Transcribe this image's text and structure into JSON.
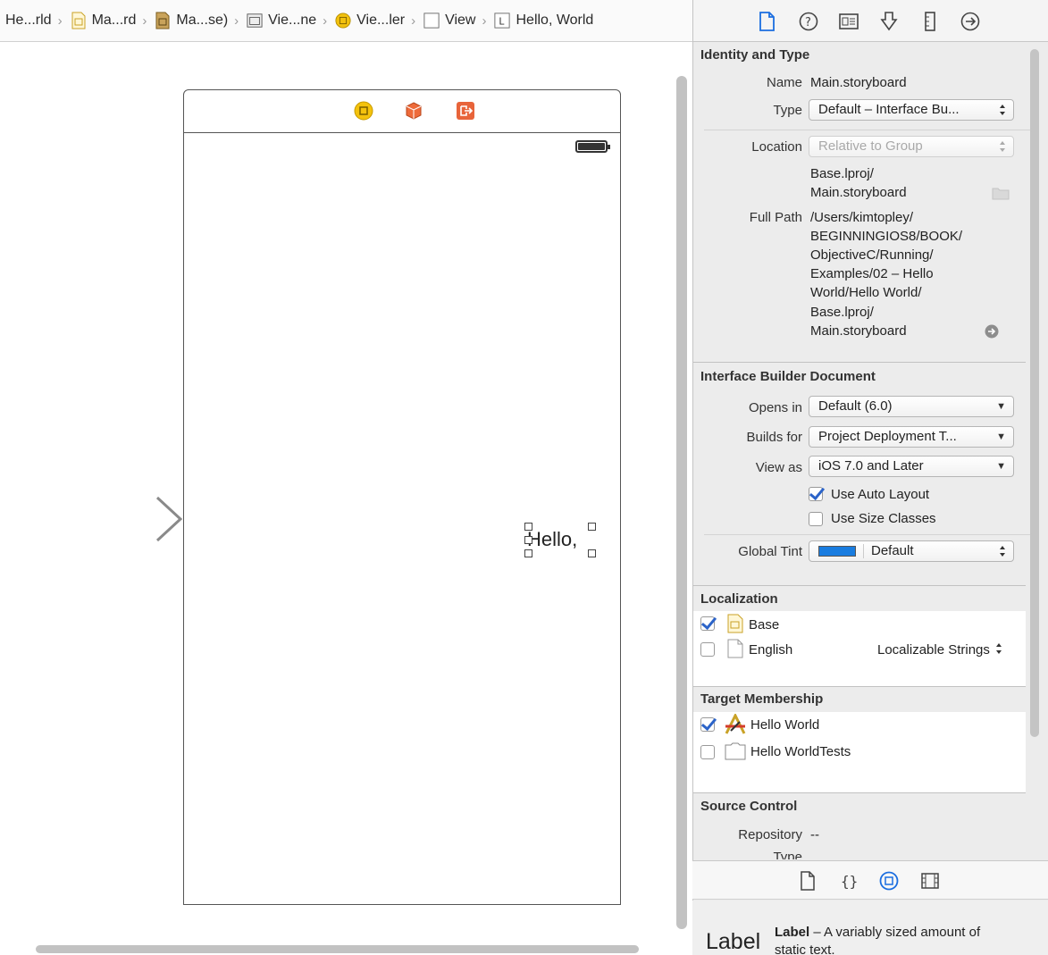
{
  "jumpbar": {
    "items": [
      {
        "label": "He...rld",
        "icon": "project-icon"
      },
      {
        "label": "Ma...rd",
        "icon": "storyboard-icon"
      },
      {
        "label": "Ma...se)",
        "icon": "storyboard-base-icon"
      },
      {
        "label": "Vie...ne",
        "icon": "scene-icon"
      },
      {
        "label": "Vie...ler",
        "icon": "view-controller-icon"
      },
      {
        "label": "View",
        "icon": "view-icon"
      },
      {
        "label": "Hello, World",
        "icon": "label-icon"
      }
    ],
    "separator": "›"
  },
  "canvas": {
    "label_text": "Hello, World"
  },
  "inspector": {
    "identity": {
      "heading": "Identity and Type",
      "name_label": "Name",
      "name_value": "Main.storyboard",
      "type_label": "Type",
      "type_value": "Default – Interface Bu...",
      "location_label": "Location",
      "location_value": "Relative to Group",
      "location_path_1": "Base.lproj/",
      "location_path_2": "Main.storyboard",
      "fullpath_label": "Full Path",
      "fullpath_lines": [
        "/Users/kimtopley/",
        "BEGINNINGIOS8/BOOK/",
        "ObjectiveC/Running/",
        "Examples/02 – Hello",
        "World/Hello World/",
        "Base.lproj/",
        "Main.storyboard"
      ]
    },
    "ibdoc": {
      "heading": "Interface Builder Document",
      "opens_in_label": "Opens in",
      "opens_in_value": "Default (6.0)",
      "builds_for_label": "Builds for",
      "builds_for_value": "Project Deployment T...",
      "view_as_label": "View as",
      "view_as_value": "iOS 7.0 and Later",
      "auto_layout_label": "Use Auto Layout",
      "auto_layout_checked": true,
      "size_classes_label": "Use Size Classes",
      "size_classes_checked": false,
      "global_tint_label": "Global Tint",
      "global_tint_value": "Default",
      "tint_color": "#1a7de0"
    },
    "localization": {
      "heading": "Localization",
      "items": [
        {
          "name": "Base",
          "checked": true,
          "extra": ""
        },
        {
          "name": "English",
          "checked": false,
          "extra": "Localizable Strings"
        }
      ]
    },
    "membership": {
      "heading": "Target Membership",
      "items": [
        {
          "name": "Hello World",
          "checked": true
        },
        {
          "name": "Hello WorldTests",
          "checked": false
        }
      ]
    },
    "source_control": {
      "heading": "Source Control",
      "repository_label": "Repository",
      "repository_value": "--",
      "type_label": "Type"
    }
  },
  "library": {
    "preview": "Label",
    "title": "Label",
    "description": " – A variably sized amount of",
    "description_2": "static text."
  }
}
